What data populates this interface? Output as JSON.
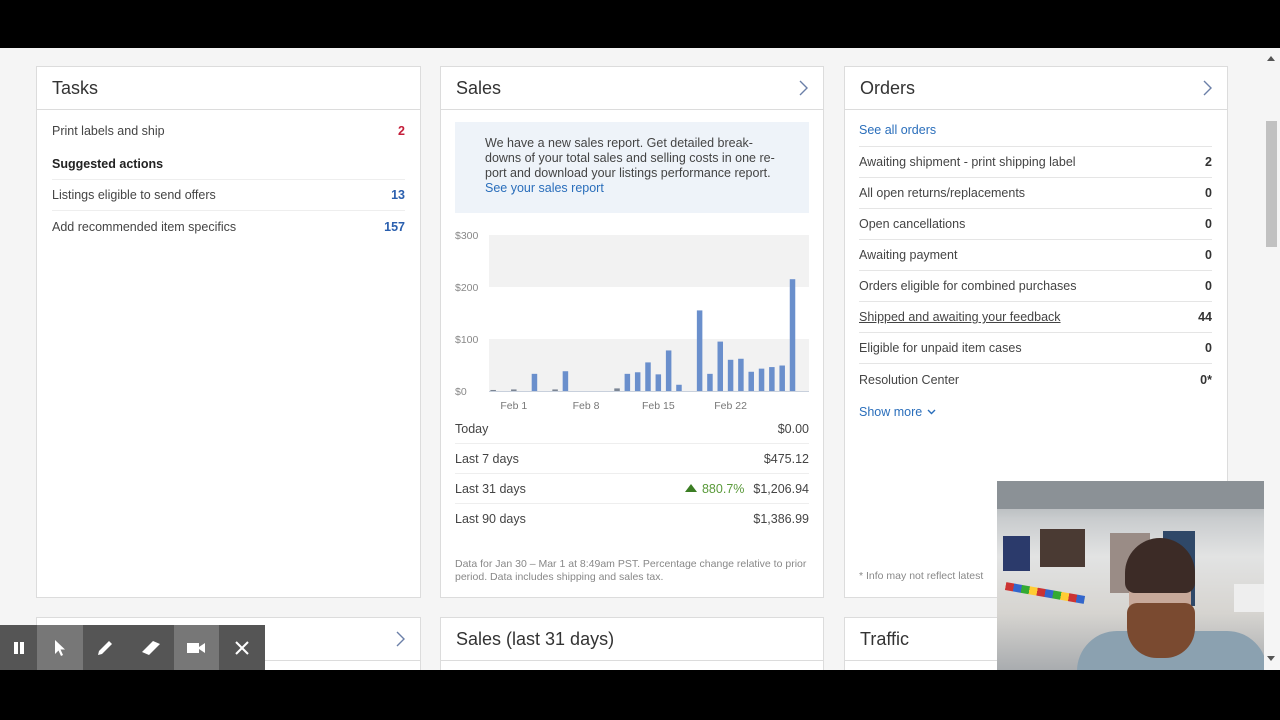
{
  "tasks": {
    "title": "Tasks",
    "items": [
      {
        "label": "Print labels and ship",
        "count": "2"
      }
    ],
    "suggested_heading": "Suggested actions",
    "suggested": [
      {
        "label": "Listings eligible to send offers",
        "count": "13"
      },
      {
        "label": "Add recommended item specifics",
        "count": "157"
      }
    ]
  },
  "sales": {
    "title": "Sales",
    "promo_text": "We have a new sales report. Get detailed break-downs of your total sales and selling costs in one re-port and download your listings performance report.",
    "promo_line1": "We have a new sales report. Get detailed break-",
    "promo_line2": "downs of your total sales and selling costs in one re-",
    "promo_line3": "port and download your listings performance report.",
    "promo_link": "See your sales report",
    "summary": [
      {
        "label": "Today",
        "value": "$0.00"
      },
      {
        "label": "Last 7 days",
        "value": "$475.12"
      },
      {
        "label": "Last 31 days",
        "change": "880.7%",
        "change_direction": "up",
        "value": "$1,206.94"
      },
      {
        "label": "Last 90 days",
        "value": "$1,386.99"
      }
    ],
    "footnote": "Data for Jan 30 – Mar 1 at 8:49am PST. Percentage change relative to prior period. Data includes shipping and sales tax."
  },
  "chart_data": {
    "type": "bar",
    "title": "",
    "xlabel": "",
    "ylabel": "",
    "ylim": [
      0,
      300
    ],
    "yticks": [
      "$0",
      "$100",
      "$200",
      "$300"
    ],
    "ytick_values": [
      0,
      100,
      200,
      300
    ],
    "xtick_labels": [
      "Feb 1",
      "Feb 8",
      "Feb 15",
      "Feb 22"
    ],
    "xtick_indices": [
      2,
      9,
      16,
      23
    ],
    "categories": [
      "Jan 30",
      "Jan 31",
      "Feb 1",
      "Feb 2",
      "Feb 3",
      "Feb 4",
      "Feb 5",
      "Feb 6",
      "Feb 7",
      "Feb 8",
      "Feb 9",
      "Feb 10",
      "Feb 11",
      "Feb 12",
      "Feb 13",
      "Feb 14",
      "Feb 15",
      "Feb 16",
      "Feb 17",
      "Feb 18",
      "Feb 19",
      "Feb 20",
      "Feb 21",
      "Feb 22",
      "Feb 23",
      "Feb 24",
      "Feb 25",
      "Feb 26",
      "Feb 27",
      "Feb 28",
      "Mar 1"
    ],
    "values": [
      2,
      0,
      3,
      0,
      33,
      0,
      3,
      38,
      0,
      0,
      0,
      0,
      5,
      33,
      36,
      55,
      32,
      78,
      12,
      0,
      155,
      33,
      95,
      60,
      62,
      37,
      43,
      46,
      49,
      215,
      0
    ],
    "bar_color": "#6a8fcc",
    "grid": "alternating bands"
  },
  "orders": {
    "title": "Orders",
    "see_all": "See all orders",
    "items": [
      {
        "label": "Awaiting shipment - print shipping label",
        "count": "2"
      },
      {
        "label": "All open returns/replacements",
        "count": "0"
      },
      {
        "label": "Open cancellations",
        "count": "0"
      },
      {
        "label": "Awaiting payment",
        "count": "0"
      },
      {
        "label": "Orders eligible for combined purchases",
        "count": "0"
      },
      {
        "label": "Shipped and awaiting your feedback",
        "count": "44"
      },
      {
        "label": "Eligible for unpaid item cases",
        "count": "0"
      },
      {
        "label": "Resolution Center",
        "count": "0*"
      }
    ],
    "show_more": "Show more",
    "info_note": "* Info may not reflect latest"
  },
  "second_row": {
    "card4_title": "",
    "card5_title": "Sales (last 31 days)",
    "card6_title": "Traffic"
  },
  "recorder_toolbar": {
    "buttons": [
      "pause-icon",
      "cursor-icon",
      "pen-icon",
      "eraser-icon",
      "camera-icon",
      "close-icon"
    ]
  },
  "colors": {
    "link": "#2a6ebb",
    "task_count_red": "#c41e3a",
    "task_count_blue": "#2a5fae",
    "increase_green": "#5a9a3a",
    "bar": "#6a8fcc"
  }
}
